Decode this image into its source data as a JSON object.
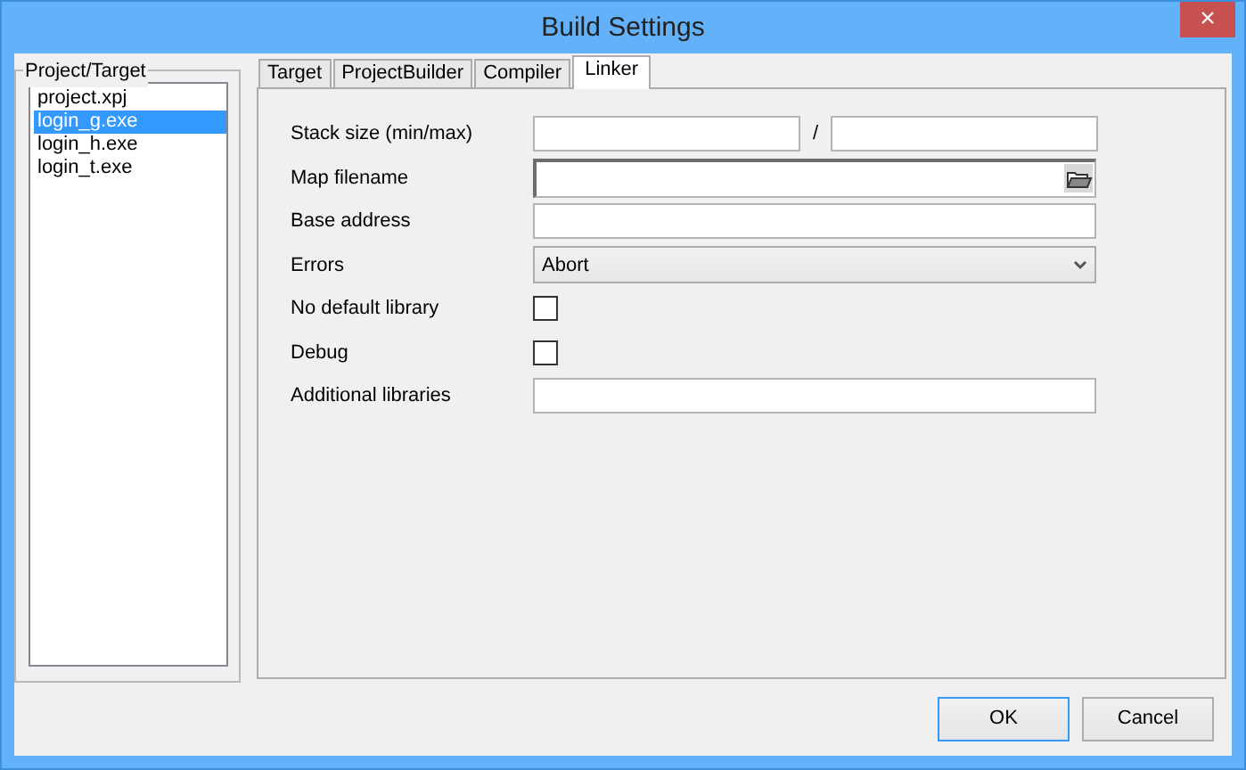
{
  "window": {
    "title": "Build Settings",
    "close": "×"
  },
  "project_target": {
    "title": "Project/Target",
    "items": [
      {
        "label": "project.xpj",
        "selected": false
      },
      {
        "label": "login_g.exe",
        "selected": true
      },
      {
        "label": "login_h.exe",
        "selected": false
      },
      {
        "label": "login_t.exe",
        "selected": false
      }
    ]
  },
  "tabs": [
    {
      "label": "Target",
      "selected": false
    },
    {
      "label": "ProjectBuilder",
      "selected": false
    },
    {
      "label": "Compiler",
      "selected": false
    },
    {
      "label": "Linker",
      "selected": true
    }
  ],
  "fields": [
    {
      "kind": "range",
      "label": "Stack size (min/max)",
      "separator": "/"
    },
    {
      "kind": "file",
      "label": "Map filename"
    },
    {
      "kind": "text",
      "label": "Base address"
    },
    {
      "kind": "select",
      "label": "Errors",
      "value": "Abort"
    },
    {
      "kind": "checkbox",
      "label": "No default library",
      "checked": false
    },
    {
      "kind": "checkbox",
      "label": "Debug",
      "checked": false
    },
    {
      "kind": "text",
      "label": "Additional libraries"
    }
  ],
  "buttons": [
    {
      "label": "OK",
      "default": true
    },
    {
      "label": "Cancel",
      "default": false
    }
  ]
}
